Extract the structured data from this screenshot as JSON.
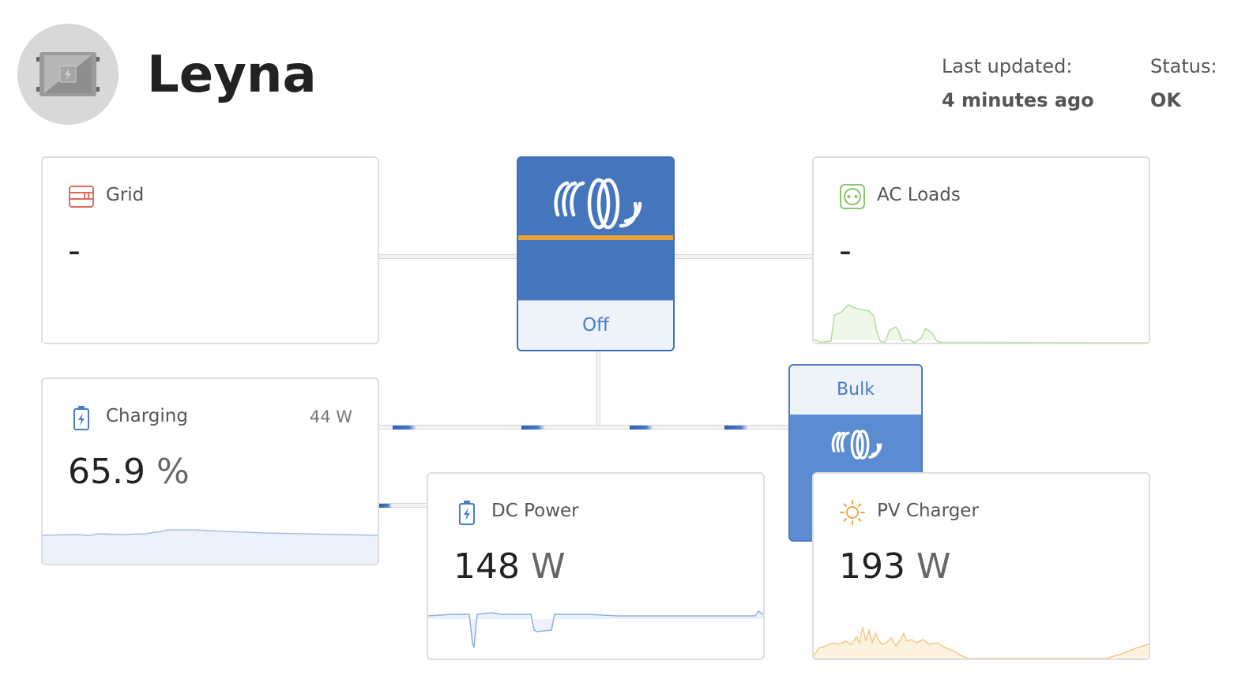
{
  "header": {
    "site_name": "Leyna",
    "last_updated_label": "Last updated:",
    "last_updated_value": "4 minutes ago",
    "status_label": "Status:",
    "status_value": "OK"
  },
  "inverter": {
    "state": "Off",
    "icon": "victron-logo-icon"
  },
  "solar_device": {
    "state": "Bulk",
    "icon": "victron-logo-icon"
  },
  "tiles": {
    "grid": {
      "title": "Grid",
      "value": "-",
      "icon": "grid-icon",
      "color": "#e06a5e"
    },
    "ac_loads": {
      "title": "AC Loads",
      "value": "-",
      "icon": "socket-icon",
      "color": "#8cc66d"
    },
    "battery": {
      "title": "Charging",
      "power": "44 W",
      "value": "65.9",
      "unit": "%",
      "icon": "battery-icon",
      "color": "#4a7bc8"
    },
    "dc_power": {
      "title": "DC Power",
      "value": "148",
      "unit": "W",
      "icon": "battery-icon",
      "color": "#4a7bc8"
    },
    "pv_charger": {
      "title": "PV Charger",
      "value": "193",
      "unit": "W",
      "icon": "sun-icon",
      "color": "#f0a64a"
    }
  }
}
